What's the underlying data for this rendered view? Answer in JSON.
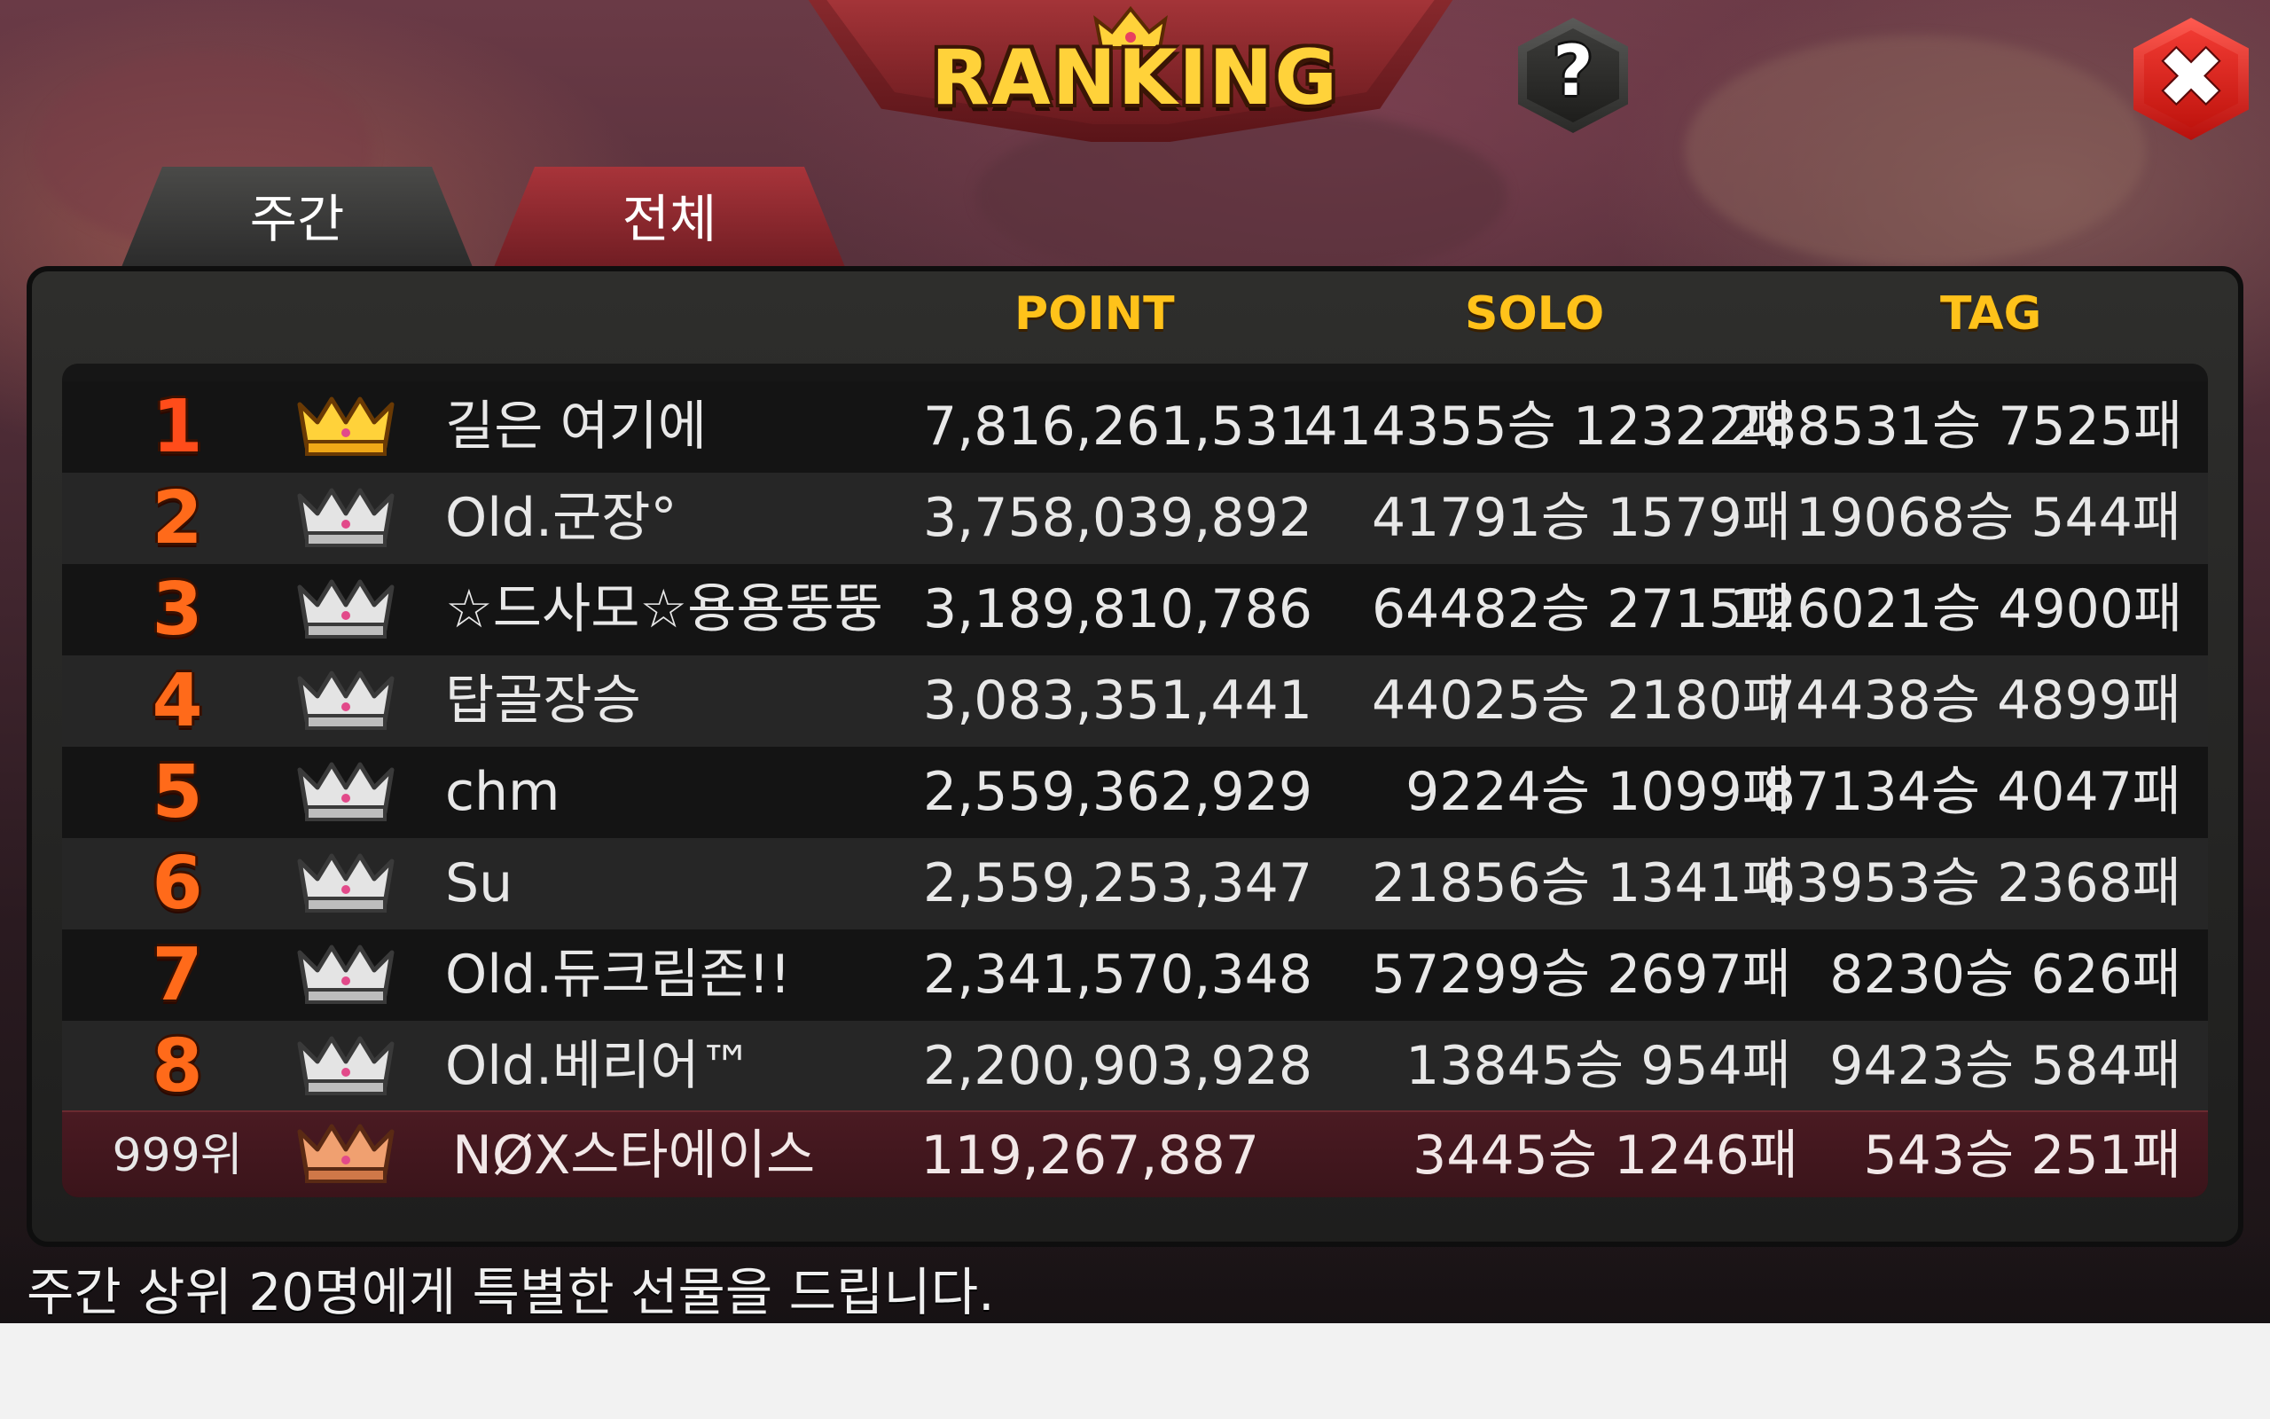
{
  "title": "RANKING",
  "buttons": {
    "help_label": "?",
    "close_label": "✖"
  },
  "tabs": [
    {
      "label": "주간",
      "active": true
    },
    {
      "label": "전체",
      "active": false
    }
  ],
  "columns": {
    "point": "POINT",
    "solo": "SOLO",
    "tag": "TAG"
  },
  "rows": [
    {
      "rank": "1",
      "name": "길은 여기에",
      "point": "7,816,261,531",
      "solo": "414355승 12322패",
      "tag": "288531승 7525패",
      "crown": "gold"
    },
    {
      "rank": "2",
      "name": "Old.군장°",
      "point": "3,758,039,892",
      "solo": "41791승 1579패",
      "tag": "19068승 544패",
      "crown": "silver"
    },
    {
      "rank": "3",
      "name": "☆드사모☆용용뚱뚱",
      "point": "3,189,810,786",
      "solo": "64482승 2715패",
      "tag": "126021승 4900패",
      "crown": "silver"
    },
    {
      "rank": "4",
      "name": "탑골장승",
      "point": "3,083,351,441",
      "solo": "44025승 2180패",
      "tag": "74438승 4899패",
      "crown": "silver"
    },
    {
      "rank": "5",
      "name": "chm",
      "point": "2,559,362,929",
      "solo": "9224승 1099패",
      "tag": "87134승 4047패",
      "crown": "silver"
    },
    {
      "rank": "6",
      "name": "Su",
      "point": "2,559,253,347",
      "solo": "21856승 1341패",
      "tag": "63953승 2368패",
      "crown": "silver"
    },
    {
      "rank": "7",
      "name": "Old.듀크림존!!",
      "point": "2,341,570,348",
      "solo": "57299승 2697패",
      "tag": "8230승 626패",
      "crown": "silver"
    },
    {
      "rank": "8",
      "name": "Old.베리어™",
      "point": "2,200,903,928",
      "solo": "13845승 954패",
      "tag": "9423승 584패",
      "crown": "silver"
    }
  ],
  "my_row": {
    "rank": "999위",
    "name": "NØX스타에이스",
    "point": "119,267,887",
    "solo": "3445승 1246패",
    "tag": "543승 251패",
    "crown": "bronze"
  },
  "footer": "주간 상위 20명에게 특별한 선물을 드립니다.",
  "colors": {
    "accent": "#ffc21a",
    "rank": "#ff6a1a",
    "tab_active_red": "#a8343a",
    "close": "#e8231c"
  },
  "icons": {
    "title": "crown-icon",
    "help": "question-icon",
    "close": "close-icon",
    "row": "crown-icon"
  }
}
